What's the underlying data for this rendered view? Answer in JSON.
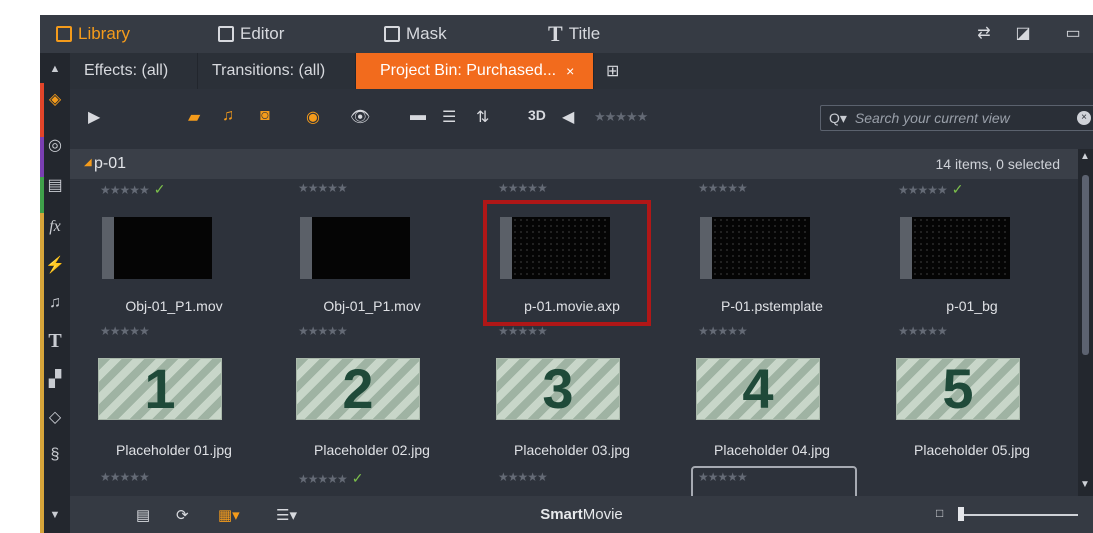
{
  "nav": {
    "library": "Library",
    "editor": "Editor",
    "mask": "Mask",
    "title": "Title"
  },
  "tabs": [
    {
      "label": "Effects: (all)"
    },
    {
      "label": "Transitions: (all)"
    },
    {
      "label": "Project Bin: Purchased...",
      "close": "×"
    }
  ],
  "search": {
    "placeholder": "Search your current view"
  },
  "group": {
    "name": "p-01",
    "count": "14 items, 0 selected"
  },
  "row1": [
    {
      "name": "Obj-01_P1.mov",
      "top_stars": "★★★★★",
      "checked": "✓"
    },
    {
      "name": "Obj-01_P1.mov",
      "top_stars": "★★★★★",
      "checked": ""
    },
    {
      "name": "p-01.movie.axp",
      "top_stars": "★★★★★",
      "checked": ""
    },
    {
      "name": "P-01.pstemplate",
      "top_stars": "★★★★★",
      "checked": ""
    },
    {
      "name": "p-01_bg",
      "top_stars": "★★★★★",
      "checked": "✓"
    }
  ],
  "row2": [
    {
      "name": "Placeholder 01.jpg",
      "number": "1",
      "stars": "★★★★★",
      "checked": ""
    },
    {
      "name": "Placeholder 02.jpg",
      "number": "2",
      "stars": "★★★★★",
      "checked": "✓"
    },
    {
      "name": "Placeholder 03.jpg",
      "number": "3",
      "stars": "★★★★★",
      "checked": ""
    },
    {
      "name": "Placeholder 04.jpg",
      "number": "4",
      "stars": "★★★★★",
      "checked": ""
    },
    {
      "name": "Placeholder 05.jpg",
      "number": "5",
      "stars": "★★★★★",
      "checked": ""
    }
  ],
  "toolbar": {
    "label_3d": "3D",
    "rating": "★★★★★"
  },
  "bottom": {
    "smart": "Smart",
    "movie": "Movie"
  },
  "colors": {
    "accent": "#f49b1b",
    "active_tab": "#f26b1d",
    "highlight": "#b01717",
    "check": "#7cc04b"
  }
}
